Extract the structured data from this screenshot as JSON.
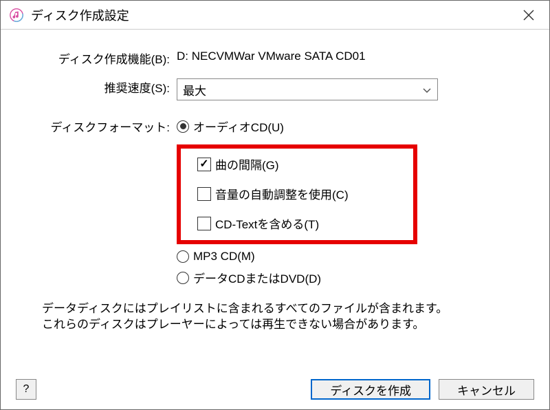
{
  "window": {
    "title": "ディスク作成設定"
  },
  "burner": {
    "label": "ディスク作成機能(B):",
    "value": "D: NECVMWar VMware SATA CD01"
  },
  "speed": {
    "label": "推奨速度(S):",
    "value": "最大"
  },
  "format": {
    "label": "ディスクフォーマット:",
    "audio_cd": "オーディオCD(U)",
    "gap": "曲の間隔(G)",
    "soundcheck": "音量の自動調整を使用(C)",
    "cdtext": "CD-Textを含める(T)",
    "mp3_cd": "MP3 CD(M)",
    "data_cd": "データCDまたはDVD(D)"
  },
  "info": {
    "line1": "データディスクにはプレイリストに含まれるすべてのファイルが含まれます。",
    "line2": "これらのディスクはプレーヤーによっては再生できない場合があります。"
  },
  "buttons": {
    "help": "?",
    "burn": "ディスクを作成",
    "cancel": "キャンセル"
  }
}
